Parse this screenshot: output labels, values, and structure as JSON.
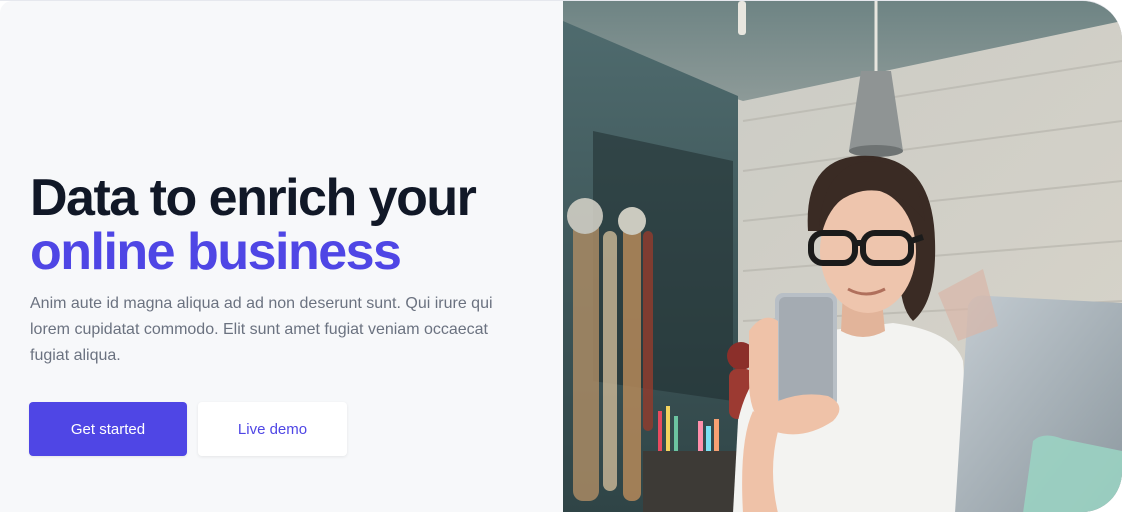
{
  "hero": {
    "headline_line1": "Data to enrich your",
    "headline_line2": "online business",
    "description": "Anim aute id magna aliqua ad ad non deserunt sunt. Qui irure qui lorem cupidatat commodo. Elit sunt amet fugiat veniam occaecat fugiat aliqua.",
    "primary_button": "Get started",
    "secondary_button": "Live demo"
  },
  "colors": {
    "accent": "#4f46e5",
    "heading": "#111827",
    "body_text": "#6b7280",
    "panel_background": "#f7f8fa"
  }
}
